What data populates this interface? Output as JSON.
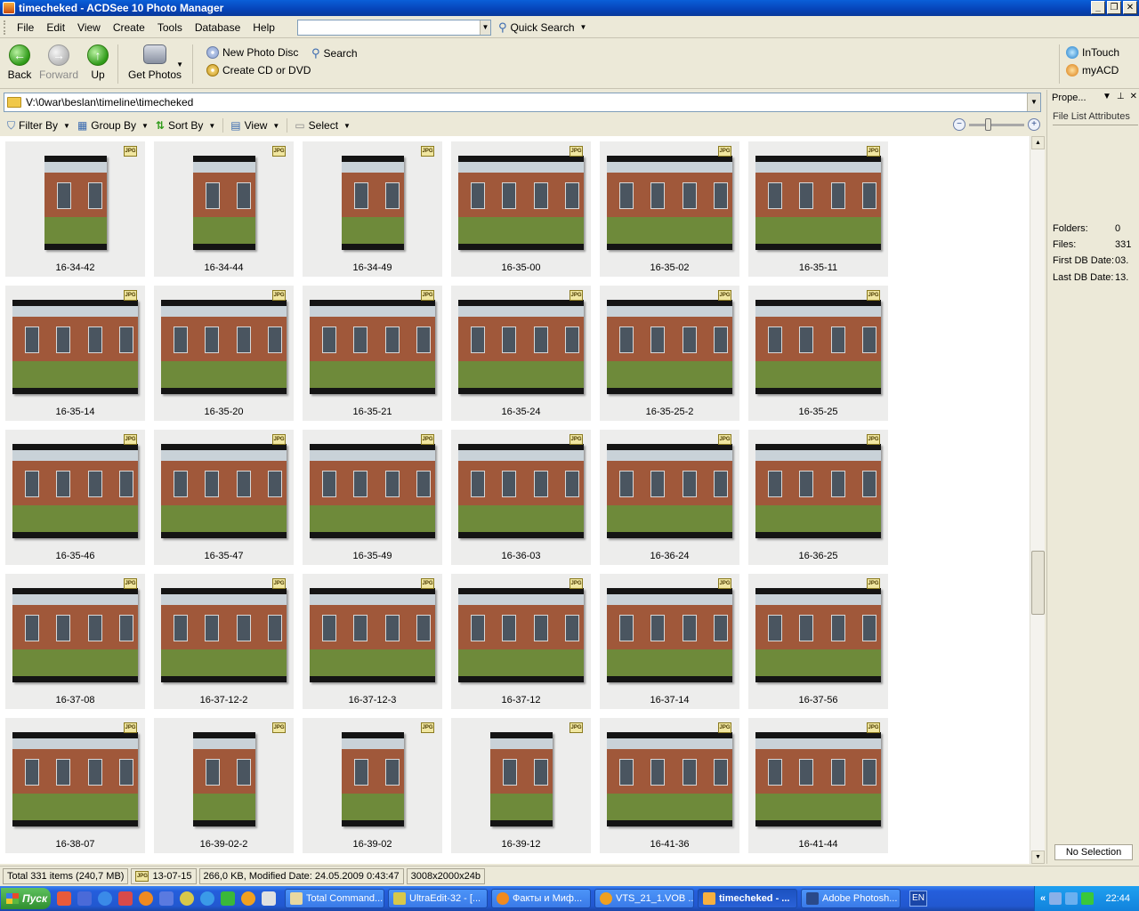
{
  "window": {
    "title": "timecheked - ACDSee 10 Photo Manager"
  },
  "menu": [
    {
      "id": "file",
      "label": "File"
    },
    {
      "id": "edit",
      "label": "Edit"
    },
    {
      "id": "view",
      "label": "View"
    },
    {
      "id": "create",
      "label": "Create"
    },
    {
      "id": "tools",
      "label": "Tools"
    },
    {
      "id": "database",
      "label": "Database"
    },
    {
      "id": "help",
      "label": "Help"
    }
  ],
  "quick_search": {
    "label": "Quick Search",
    "value": ""
  },
  "toolbar": {
    "back": "Back",
    "forward": "Forward",
    "up": "Up",
    "get_photos": "Get Photos",
    "new_photo_disc": "New Photo Disc",
    "create_cd": "Create CD or DVD",
    "search": "Search",
    "intouch": "InTouch",
    "myacd": "myACD"
  },
  "path": "V:\\0war\\beslan\\timeline\\timecheked",
  "filterbar": {
    "filter_by": "Filter By",
    "group_by": "Group By",
    "sort_by": "Sort By",
    "view": "View",
    "select": "Select"
  },
  "zoom": {
    "level": 0.33
  },
  "scrollbar": {
    "position": 0.63
  },
  "thumbnails": [
    {
      "name": "16-34-42",
      "badge": "JPG",
      "orientation": "portrait"
    },
    {
      "name": "16-34-44",
      "badge": "JPG",
      "orientation": "portrait"
    },
    {
      "name": "16-34-49",
      "badge": "JPG",
      "orientation": "portrait"
    },
    {
      "name": "16-35-00",
      "badge": "JPG",
      "orientation": "landscape"
    },
    {
      "name": "16-35-02",
      "badge": "JPG",
      "orientation": "landscape"
    },
    {
      "name": "16-35-11",
      "badge": "JPG",
      "orientation": "landscape"
    },
    {
      "name": "16-35-14",
      "badge": "JPG",
      "orientation": "landscape"
    },
    {
      "name": "16-35-20",
      "badge": "JPG",
      "orientation": "landscape"
    },
    {
      "name": "16-35-21",
      "badge": "JPG",
      "orientation": "landscape"
    },
    {
      "name": "16-35-24",
      "badge": "JPG",
      "orientation": "landscape"
    },
    {
      "name": "16-35-25-2",
      "badge": "JPG",
      "orientation": "landscape"
    },
    {
      "name": "16-35-25",
      "badge": "JPG",
      "orientation": "landscape"
    },
    {
      "name": "16-35-46",
      "badge": "JPG",
      "orientation": "landscape"
    },
    {
      "name": "16-35-47",
      "badge": "JPG",
      "orientation": "landscape"
    },
    {
      "name": "16-35-49",
      "badge": "JPG",
      "orientation": "landscape"
    },
    {
      "name": "16-36-03",
      "badge": "JPG",
      "orientation": "landscape"
    },
    {
      "name": "16-36-24",
      "badge": "JPG",
      "orientation": "landscape"
    },
    {
      "name": "16-36-25",
      "badge": "JPG",
      "orientation": "landscape"
    },
    {
      "name": "16-37-08",
      "badge": "JPG",
      "orientation": "landscape"
    },
    {
      "name": "16-37-12-2",
      "badge": "JPG",
      "orientation": "landscape"
    },
    {
      "name": "16-37-12-3",
      "badge": "JPG",
      "orientation": "landscape"
    },
    {
      "name": "16-37-12",
      "badge": "JPG",
      "orientation": "landscape"
    },
    {
      "name": "16-37-14",
      "badge": "JPG",
      "orientation": "landscape"
    },
    {
      "name": "16-37-56",
      "badge": "JPG",
      "orientation": "landscape"
    },
    {
      "name": "16-38-07",
      "badge": "JPG",
      "orientation": "landscape"
    },
    {
      "name": "16-39-02-2",
      "badge": "JPG",
      "orientation": "portrait"
    },
    {
      "name": "16-39-02",
      "badge": "JPG",
      "orientation": "portrait"
    },
    {
      "name": "16-39-12",
      "badge": "JPG",
      "orientation": "portrait"
    },
    {
      "name": "16-41-36",
      "badge": "JPG",
      "orientation": "landscape"
    },
    {
      "name": "16-41-44",
      "badge": "JPG",
      "orientation": "landscape"
    }
  ],
  "properties": {
    "title": "Prope...",
    "tab": "File List Attributes",
    "rows": [
      {
        "key": "Folders:",
        "value": "0"
      },
      {
        "key": "Files:",
        "value": "331"
      },
      {
        "key": "First DB Date:",
        "value": "03."
      },
      {
        "key": "Last DB Date:",
        "value": "13."
      }
    ],
    "bottom_tab": "No Selection"
  },
  "status": {
    "total": "Total 331 items  (240,7 MB)",
    "file_name": "13-07-15",
    "size_info": "266,0 KB, Modified Date: 24.05.2009 0:43:47",
    "dimensions": "3008x2000x24b"
  },
  "taskbar": {
    "start": "Пуск",
    "tasks": [
      {
        "label": "Total Command...",
        "active": false
      },
      {
        "label": "UltraEdit-32 - [...",
        "active": false
      },
      {
        "label": "Факты и Миф...",
        "active": false
      },
      {
        "label": "VTS_21_1.VOB ...",
        "active": false
      },
      {
        "label": "timecheked - ...",
        "active": true
      },
      {
        "label": "Adobe Photosh...",
        "active": false
      }
    ],
    "language": "EN",
    "clock": "22:44"
  }
}
